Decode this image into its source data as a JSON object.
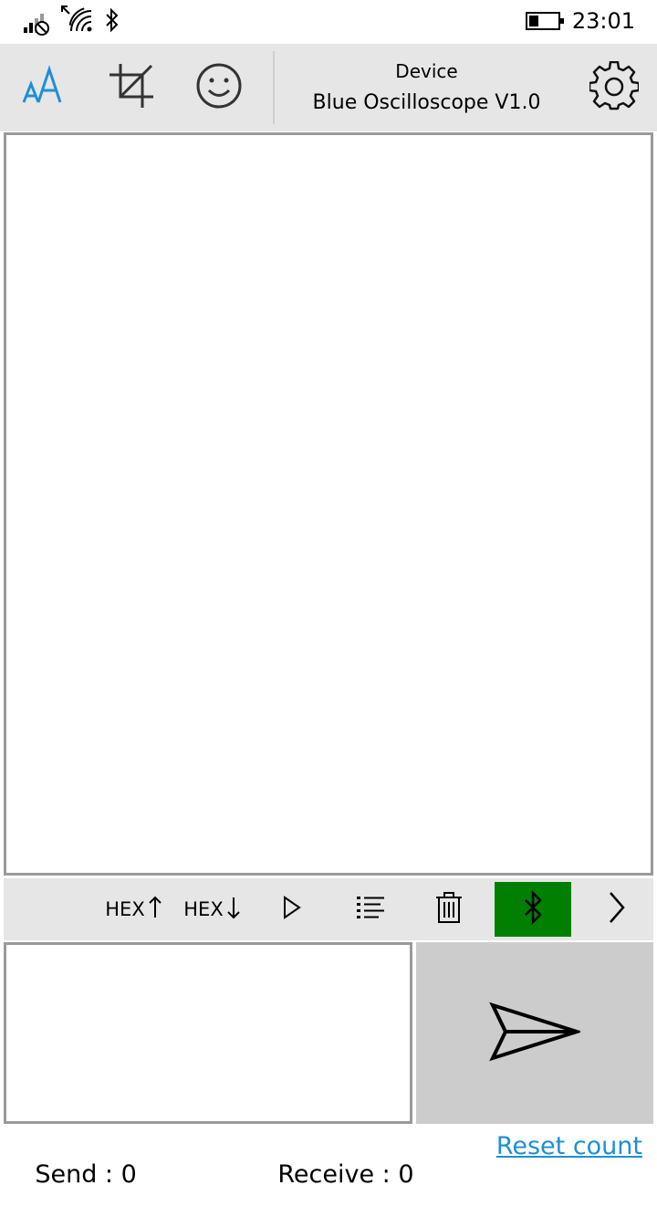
{
  "status_bar": {
    "time": "23:01",
    "icons": [
      "signal-no-sim-icon",
      "data-transfer-icon",
      "wifi-icon",
      "bluetooth-icon",
      "battery-icon"
    ]
  },
  "toolbar": {
    "font_size_icon": "font-size-icon",
    "crop_icon": "crop-icon",
    "emoji_icon": "emoji-icon",
    "device_caption": "Device",
    "device_name": "Blue Oscilloscope V1.0",
    "settings_icon": "gear-icon",
    "accent_color": "#1e8fd6"
  },
  "receive": {
    "content": ""
  },
  "actions": {
    "hex_send_label": "HEX",
    "hex_receive_label": "HEX",
    "bluetooth_active_color": "#007f00"
  },
  "send": {
    "value": "",
    "placeholder": ""
  },
  "counters": {
    "send_label": "Send : ",
    "send_value": "0",
    "receive_label": "Receive : ",
    "receive_value": "0",
    "reset_label": "Reset count"
  }
}
